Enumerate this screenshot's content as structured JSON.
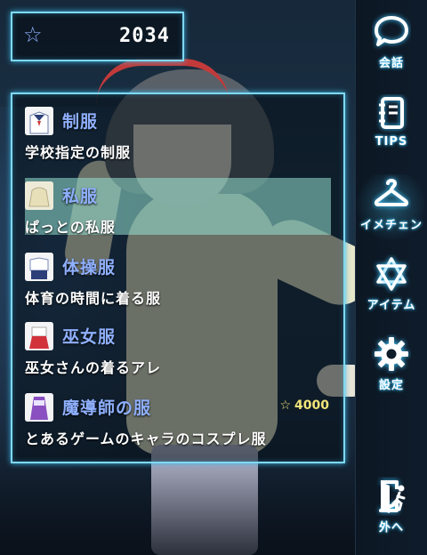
{
  "stars": {
    "icon": "star-icon",
    "value": "2034"
  },
  "costumes": [
    {
      "name": "制服",
      "description": "学校指定の制服",
      "icon": "school-uniform-icon",
      "selected": false
    },
    {
      "name": "私服",
      "description": "ぱっとの私服",
      "icon": "casual-clothes-icon",
      "selected": true
    },
    {
      "name": "体操服",
      "description": "体育の時間に着る服",
      "icon": "gym-clothes-icon",
      "selected": false
    },
    {
      "name": "巫女服",
      "description": "巫女さんの着るアレ",
      "icon": "shrine-maiden-icon",
      "selected": false
    },
    {
      "name": "魔導師の服",
      "description": "とあるゲームのキャラのコスプレ服",
      "icon": "mage-outfit-icon",
      "selected": false,
      "price": "4000"
    }
  ],
  "sidebar": {
    "talk": "会話",
    "tips": "TIPS",
    "change_clothes": "イメチェン",
    "items": "アイテム",
    "settings": "設定",
    "go_out": "外へ"
  },
  "colors": {
    "accent": "#7ed8f2",
    "name_text": "#8fb0ff",
    "price": "#f2e57a",
    "selected_row": "#96e1d2"
  }
}
